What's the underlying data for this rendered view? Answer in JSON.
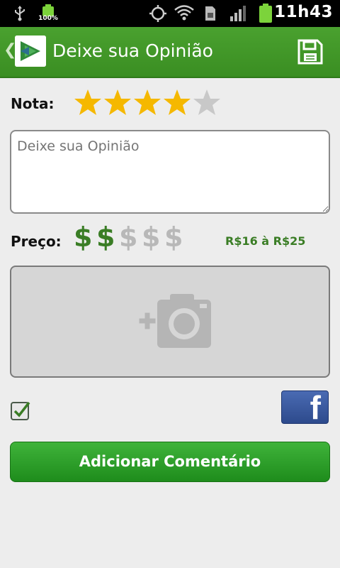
{
  "status_bar": {
    "battery_small_percent": "100%",
    "time": "11h43"
  },
  "action_bar": {
    "title": "Deixe sua Opinião",
    "icons": [
      "back-chevron-icon",
      "app-logo-icon",
      "save-icon"
    ]
  },
  "rating": {
    "label": "Nota:",
    "value": 4,
    "max": 5
  },
  "comment": {
    "placeholder": "Deixe sua Opinião",
    "value": ""
  },
  "price": {
    "label": "Preço:",
    "sign": "$",
    "level": 2,
    "max": 5,
    "range_text": "R$16 à R$25"
  },
  "photo": {
    "icon": "add-photo-camera-icon"
  },
  "share": {
    "checkbox_checked": true,
    "facebook_letter": "f"
  },
  "submit": {
    "label": "Adicionar Comentário"
  },
  "colors": {
    "accent_green": "#3a8e22",
    "price_green": "#3a7d25",
    "star_gold": "#f5b800",
    "star_gray": "#c8c8c8"
  }
}
